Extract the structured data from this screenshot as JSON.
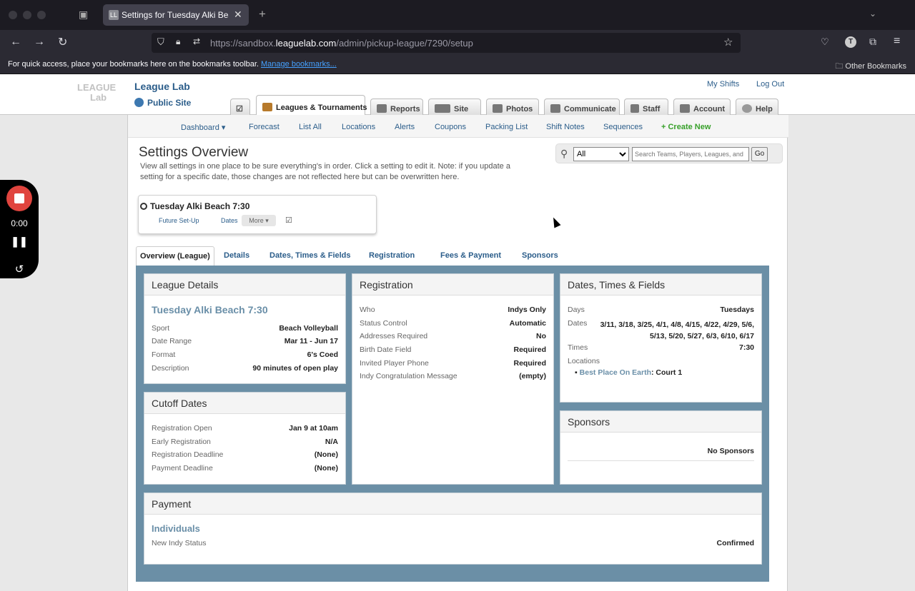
{
  "browser": {
    "tab_title": "Settings for Tuesday Alki Beach",
    "tab_favicon": "LL",
    "url_prefix": "https://sandbox.",
    "url_domain": "leaguelab.com",
    "url_path": "/admin/pickup-league/7290/setup",
    "bookmarks_hint": "For quick access, place your bookmarks here on the bookmarks toolbar.",
    "manage_bookmarks": "Manage bookmarks...",
    "other_bookmarks": "Other Bookmarks",
    "profile_initial": "T"
  },
  "site": {
    "logo_line1": "LEAGUE",
    "logo_line2": "Lab",
    "brand": "League Lab",
    "public_site": "Public Site",
    "my_shifts": "My Shifts",
    "log_out": "Log Out"
  },
  "main_tabs": [
    {
      "label": ""
    },
    {
      "label": "Leagues & Tournaments"
    },
    {
      "label": "Reports"
    },
    {
      "label": "Site"
    },
    {
      "label": "Photos"
    },
    {
      "label": "Communicate"
    },
    {
      "label": "Staff"
    },
    {
      "label": "Account"
    },
    {
      "label": "Help"
    }
  ],
  "subnav": [
    "Dashboard ▾",
    "Forecast",
    "List All",
    "Locations",
    "Alerts",
    "Coupons",
    "Packing List",
    "Shift Notes",
    "Sequences",
    "+ Create New"
  ],
  "page": {
    "title": "Settings Overview",
    "intro": "View all settings in one place to be sure everything's in order. Click a setting to edit it. Note: if you update a setting for a specific date, those changes are not reflected here but can be overwritten here."
  },
  "search": {
    "scope": "All",
    "placeholder": "Search Teams, Players, Leagues, and",
    "go": "Go"
  },
  "league_card": {
    "name": "Tuesday Alki Beach 7:30",
    "future_setup": "Future Set-Up",
    "dates": "Dates",
    "more": "More ▾"
  },
  "page_tabs": [
    "Overview (League)",
    "Details",
    "Dates, Times & Fields",
    "Registration",
    "Fees & Payment",
    "Sponsors"
  ],
  "league_details": {
    "header": "League Details",
    "name": "Tuesday Alki Beach 7:30",
    "rows": [
      {
        "k": "Sport",
        "v": "Beach Volleyball"
      },
      {
        "k": "Date Range",
        "v": "Mar 11 - Jun 17"
      },
      {
        "k": "Format",
        "v": "6's Coed"
      },
      {
        "k": "Description",
        "v": "90 minutes of open play"
      }
    ]
  },
  "cutoff_dates": {
    "header": "Cutoff Dates",
    "rows": [
      {
        "k": "Registration Open",
        "v": "Jan 9 at 10am"
      },
      {
        "k": "Early Registration",
        "v": "N/A"
      },
      {
        "k": "Registration Deadline",
        "v": "(None)"
      },
      {
        "k": "Payment Deadline",
        "v": "(None)"
      }
    ]
  },
  "registration": {
    "header": "Registration",
    "rows": [
      {
        "k": "Who",
        "v": "Indys Only"
      },
      {
        "k": "Status Control",
        "v": "Automatic"
      },
      {
        "k": "Addresses Required",
        "v": "No"
      },
      {
        "k": "Birth Date Field",
        "v": "Required"
      },
      {
        "k": "Invited Player Phone",
        "v": "Required"
      },
      {
        "k": "Indy Congratulation Message",
        "v": "(empty)"
      }
    ]
  },
  "dates_times": {
    "header": "Dates, Times & Fields",
    "days_k": "Days",
    "days_v": "Tuesdays",
    "dates_k": "Dates",
    "dates_v1": "3/11, 3/18, 3/25, 4/1, 4/8, 4/15, 4/22, 4/29, 5/6,",
    "dates_v2": "5/13, 5/20, 5/27, 6/3, 6/10, 6/17",
    "times_k": "Times",
    "times_v": "7:30",
    "locations_k": "Locations",
    "location_name": "Best Place On Earth",
    "location_court": ": Court 1"
  },
  "sponsors": {
    "header": "Sponsors",
    "empty": "No Sponsors"
  },
  "payment": {
    "header": "Payment",
    "sub": "Individuals",
    "rows": [
      {
        "k": "New Indy Status",
        "v": "Confirmed"
      }
    ]
  },
  "recorder": {
    "time": "0:00"
  }
}
